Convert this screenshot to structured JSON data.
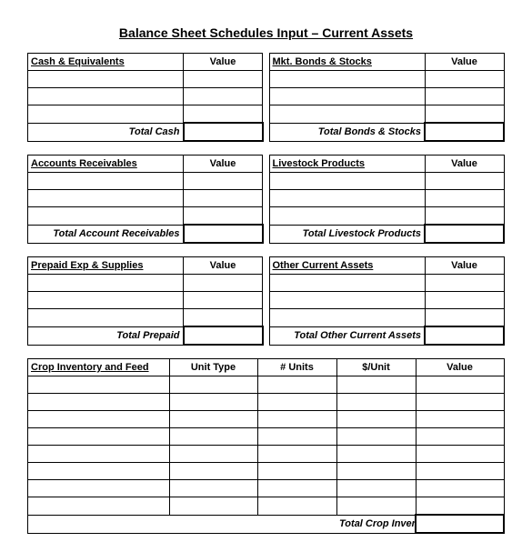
{
  "title": "Balance Sheet Schedules Input – Current Assets",
  "value_header": "Value",
  "blocks": {
    "cash": {
      "header": "Cash & Equivalents",
      "total_label": "Total Cash"
    },
    "mkt": {
      "header": "Mkt. Bonds & Stocks",
      "total_label": "Total Bonds & Stocks"
    },
    "ar": {
      "header": "Accounts Receivables",
      "total_label": "Total Account Receivables"
    },
    "livestock": {
      "header": "Livestock Products",
      "total_label": "Total Livestock Products"
    },
    "prepaid": {
      "header": "Prepaid Exp & Supplies",
      "total_label": "Total Prepaid"
    },
    "other": {
      "header": "Other Current Assets",
      "total_label": "Total Other Current Assets"
    }
  },
  "crop": {
    "header": "Crop Inventory and Feed",
    "col_unit_type": "Unit Type",
    "col_units": "# Units",
    "col_price": "$/Unit",
    "col_value": "Value",
    "total_label": "Total Crop Inventory"
  }
}
